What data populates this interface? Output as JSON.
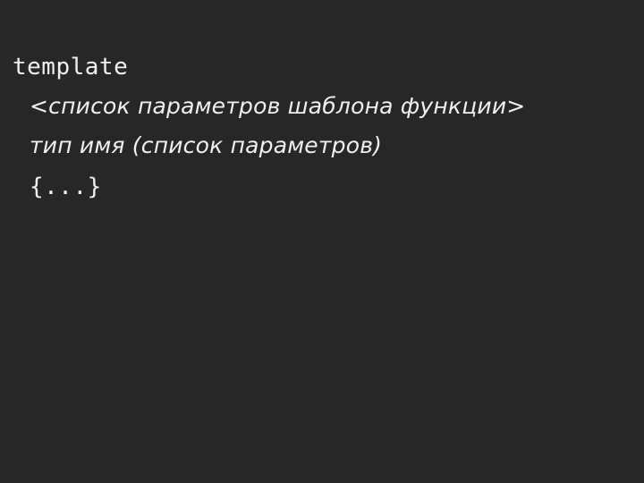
{
  "slide": {
    "background_color": "#272727",
    "text_color": "#f0f0f0",
    "code": {
      "line1_keyword": "template",
      "line2_template_parameter_list": "<список параметров шаблона функции>",
      "line3_function_signature": "тип имя (список параметров)",
      "line4_function_body": "{...}"
    }
  }
}
